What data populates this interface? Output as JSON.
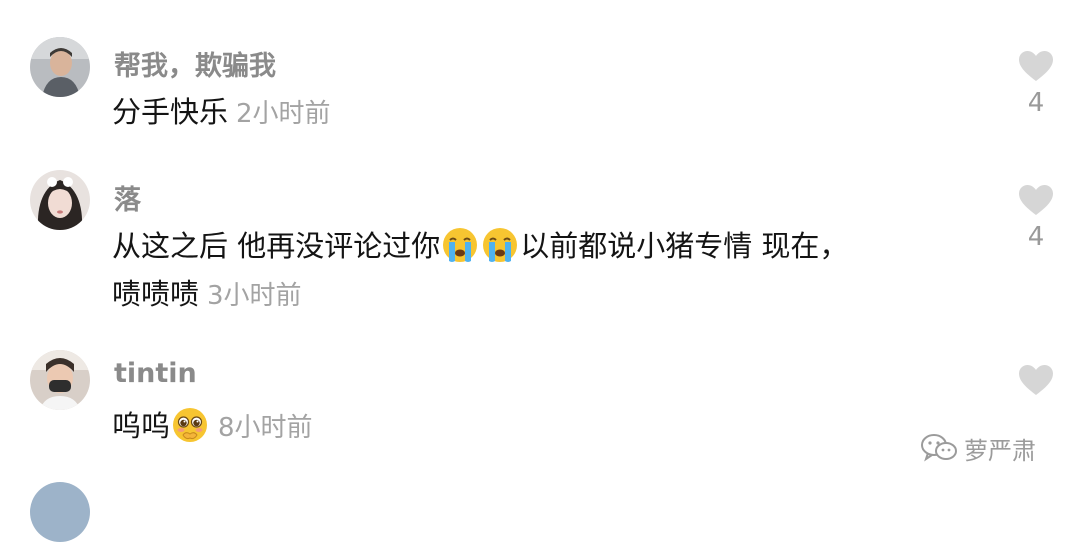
{
  "comments": [
    {
      "username": "帮我，欺骗我",
      "lines": [
        "分手快乐"
      ],
      "time": "2小时前",
      "likes": "4",
      "avatar_icon": "avatar-man-photo"
    },
    {
      "username": "落",
      "line1_a": "从这之后 他再没评论过你",
      "line1_emoji": "crying-face-emoji",
      "line1_b": "以前都说小猪专情 现在，",
      "line2": "啧啧啧",
      "time": "3小时前",
      "likes": "4",
      "avatar_icon": "avatar-girl-photo"
    },
    {
      "username": "tintin",
      "lines": [
        "呜呜"
      ],
      "emoji": "pleading-face-emoji",
      "time": "8小时前",
      "likes": "",
      "avatar_icon": "avatar-masked-photo"
    }
  ],
  "watermark": {
    "text": "萝严肃",
    "icon": "wechat-icon"
  },
  "colors": {
    "username": "#8a8a8a",
    "text": "#141414",
    "time": "#a3a3a3",
    "heart": "#d4d4d4"
  }
}
